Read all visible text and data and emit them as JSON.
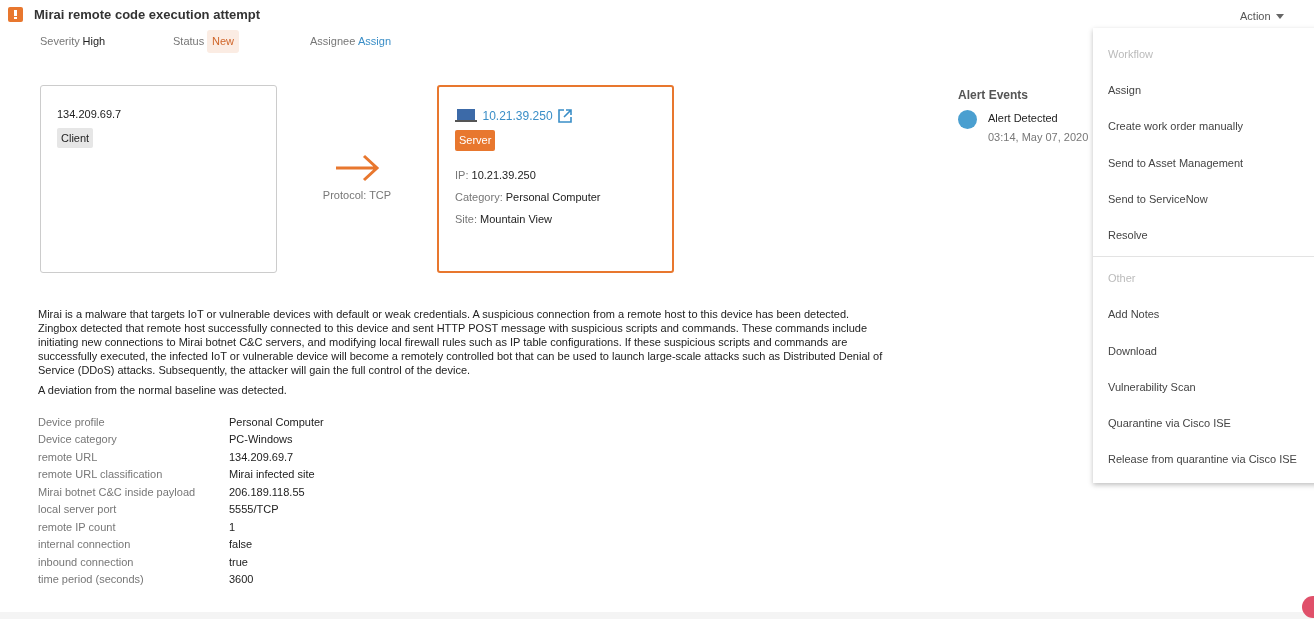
{
  "alert": {
    "title": "Mirai remote code execution attempt",
    "severity_label": "Severity",
    "severity": "High",
    "status_label": "Status",
    "status": "New",
    "assignee_label": "Assignee",
    "assignee": "Assign"
  },
  "action_button": "Action",
  "source": {
    "ip": "134.209.69.7",
    "role": "Client"
  },
  "connection": {
    "protocol": "Protocol: TCP"
  },
  "destination": {
    "ip_link": "10.21.39.250",
    "role": "Server",
    "fields": [
      {
        "label": "IP:",
        "value": "10.21.39.250"
      },
      {
        "label": "Category:",
        "value": "Personal Computer"
      },
      {
        "label": "Site:",
        "value": "Mountain View"
      }
    ]
  },
  "description": "Mirai is a malware that targets IoT or vulnerable devices with default or weak credentials. A suspicious connection from a remote host to this device has been detected. Zingbox detected that remote host successfully connected to this device and sent HTTP POST message with suspicious scripts and commands. These commands include initiating new connections to Mirai botnet C&C servers, and modifying local firewall rules such as IP table configurations. If these suspicious scripts and commands are successfully executed, the infected IoT or vulnerable device will become a remotely controlled bot that can be used to launch large-scale attacks such as Distributed Denial of Service (DDoS) attacks. Subsequently, the attacker will gain the full control of the device.",
  "deviation": "A deviation from the normal baseline was detected.",
  "details": [
    {
      "label": "Device profile",
      "value": "Personal Computer"
    },
    {
      "label": "Device category",
      "value": "PC-Windows"
    },
    {
      "label": "remote URL",
      "value": "134.209.69.7"
    },
    {
      "label": "remote URL classification",
      "value": "Mirai infected site"
    },
    {
      "label": "Mirai botnet C&C inside payload",
      "value": "206.189.118.55"
    },
    {
      "label": "local server port",
      "value": "5555/TCP"
    },
    {
      "label": "remote IP count",
      "value": "1"
    },
    {
      "label": "internal connection",
      "value": "false"
    },
    {
      "label": "inbound connection",
      "value": "true"
    },
    {
      "label": "time period (seconds)",
      "value": "3600"
    }
  ],
  "alert_events": {
    "title": "Alert Events",
    "events": [
      {
        "name": "Alert Detected",
        "time": "03:14, May 07, 2020",
        "color": "#4a9fd0"
      }
    ]
  },
  "action_menu": [
    {
      "kind": "header",
      "label": "Workflow"
    },
    {
      "kind": "item",
      "label": "Assign"
    },
    {
      "kind": "item",
      "label": "Create work order manually"
    },
    {
      "kind": "item",
      "label": "Send to Asset Management"
    },
    {
      "kind": "item",
      "label": "Send to ServiceNow"
    },
    {
      "kind": "item",
      "label": "Resolve"
    },
    {
      "kind": "divider"
    },
    {
      "kind": "header",
      "label": "Other"
    },
    {
      "kind": "item",
      "label": "Add Notes"
    },
    {
      "kind": "item",
      "label": "Download"
    },
    {
      "kind": "item",
      "label": "Vulnerability Scan"
    },
    {
      "kind": "item",
      "label": "Quarantine via Cisco ISE"
    },
    {
      "kind": "item",
      "label": "Release from quarantine via Cisco ISE"
    }
  ]
}
